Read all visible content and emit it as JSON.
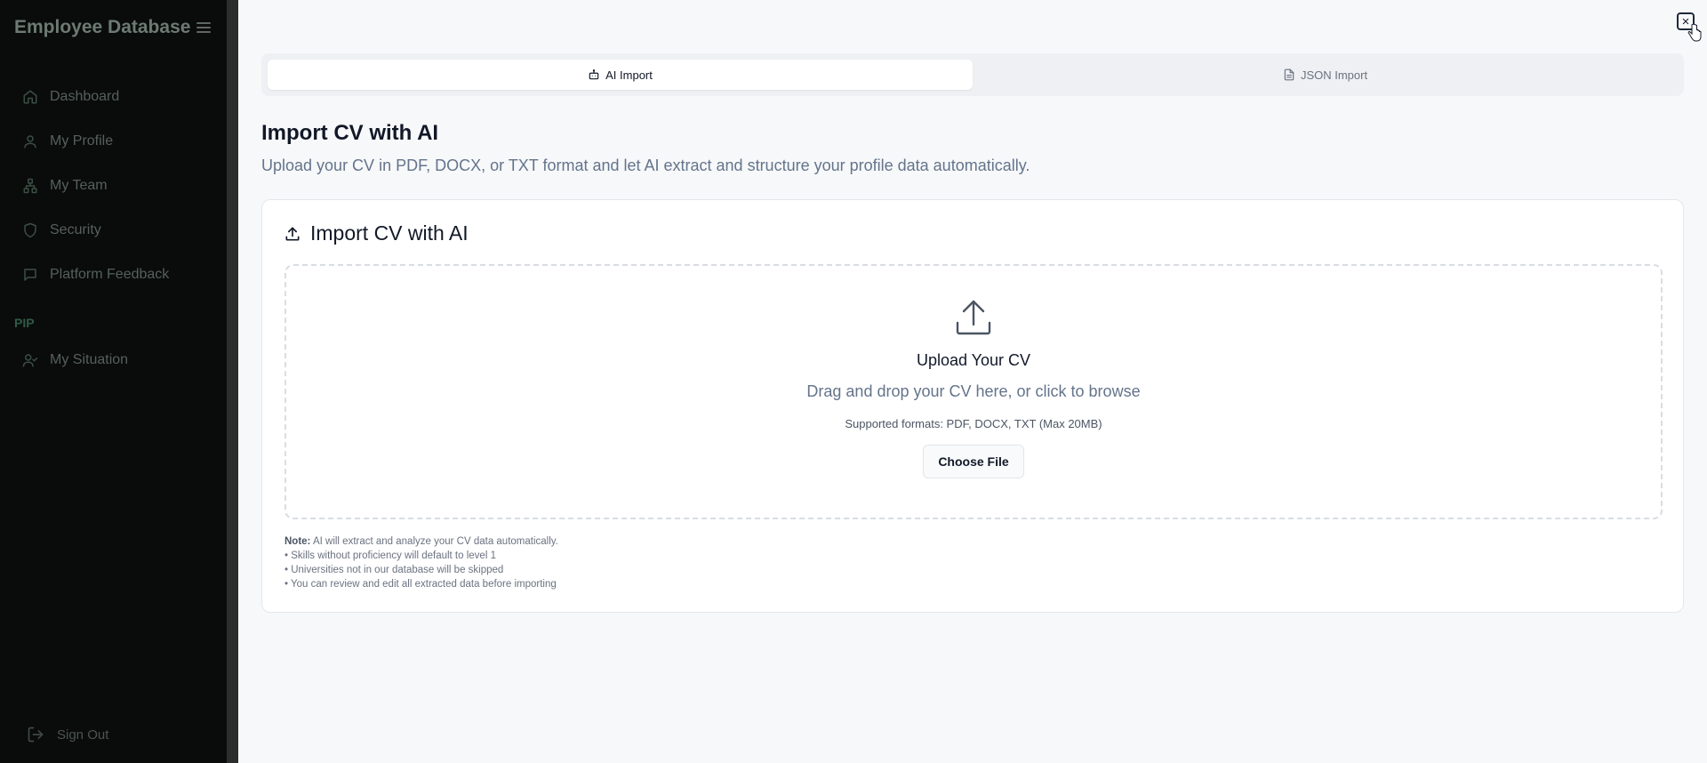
{
  "sidebar": {
    "brand": "Employee Database",
    "items": [
      {
        "label": "Dashboard",
        "icon": "home-icon"
      },
      {
        "label": "My Profile",
        "icon": "user-icon"
      },
      {
        "label": "My Team",
        "icon": "team-icon"
      },
      {
        "label": "Security",
        "icon": "shield-icon"
      },
      {
        "label": "Platform Feedback",
        "icon": "message-icon"
      }
    ],
    "section_label": "PIP",
    "section_items": [
      {
        "label": "My Situation",
        "icon": "user-check-icon"
      }
    ],
    "signout_label": "Sign Out"
  },
  "tabs": [
    {
      "label": "AI Import",
      "icon": "bot-icon",
      "active": true
    },
    {
      "label": "JSON Import",
      "icon": "file-icon",
      "active": false
    }
  ],
  "page": {
    "title": "Import CV with AI",
    "subtitle": "Upload your CV in PDF, DOCX, or TXT format and let AI extract and structure your profile data automatically."
  },
  "card": {
    "title": "Import CV with AI",
    "dropzone": {
      "title": "Upload Your CV",
      "subtitle": "Drag and drop your CV here, or click to browse",
      "formats": "Supported formats: PDF, DOCX, TXT (Max 20MB)",
      "button_label": "Choose File"
    },
    "note_label": "Note:",
    "note_text": " AI will extract and analyze your CV data automatically.",
    "note_lines": [
      "• Skills without proficiency will default to level 1",
      "• Universities not in our database will be skipped",
      "• You can review and edit all extracted data before importing"
    ]
  },
  "close_label": "×"
}
